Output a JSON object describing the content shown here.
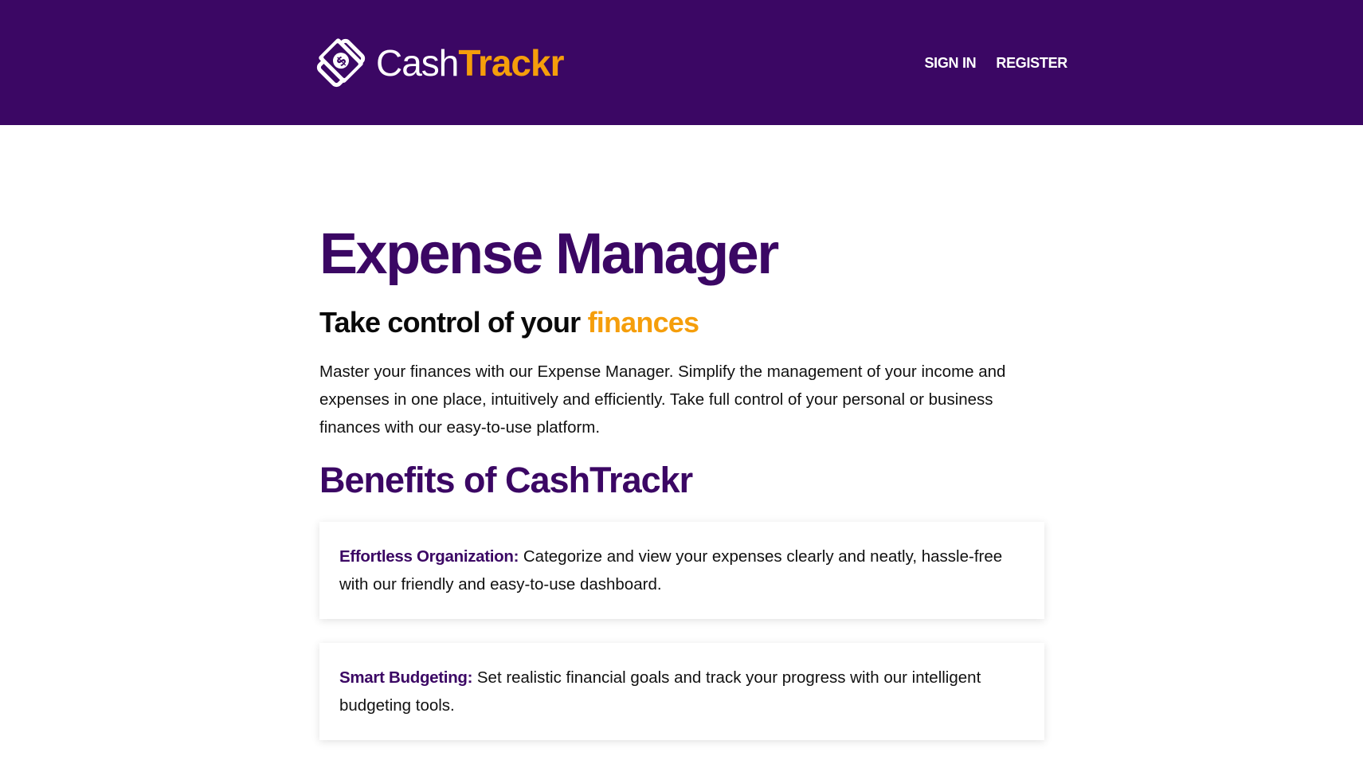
{
  "header": {
    "brand": {
      "part1": "Cash",
      "part2": "Trackr",
      "logo_icon": "wallet-dollar-icon"
    },
    "nav": [
      {
        "label": "SIGN IN"
      },
      {
        "label": "REGISTER"
      }
    ],
    "colors": {
      "background": "#3b0764",
      "accent": "#f59e0b",
      "text": "#ffffff"
    }
  },
  "main": {
    "title": "Expense Manager",
    "subtitle": {
      "text": "Take control of your ",
      "accent": "finances"
    },
    "intro": "Master your finances with our Expense Manager. Simplify the management of your income and expenses in one place, intuitively and efficiently. Take full control of your personal or business finances with our easy-to-use platform.",
    "benefits_title": "Benefits of CashTrackr",
    "benefits": [
      {
        "label": "Effortless Organization:",
        "text": " Categorize and view your expenses clearly and neatly, hassle-free with our friendly and easy-to-use dashboard."
      },
      {
        "label": "Smart Budgeting:",
        "text": " Set realistic financial goals and track your progress with our intelligent budgeting tools."
      }
    ]
  }
}
